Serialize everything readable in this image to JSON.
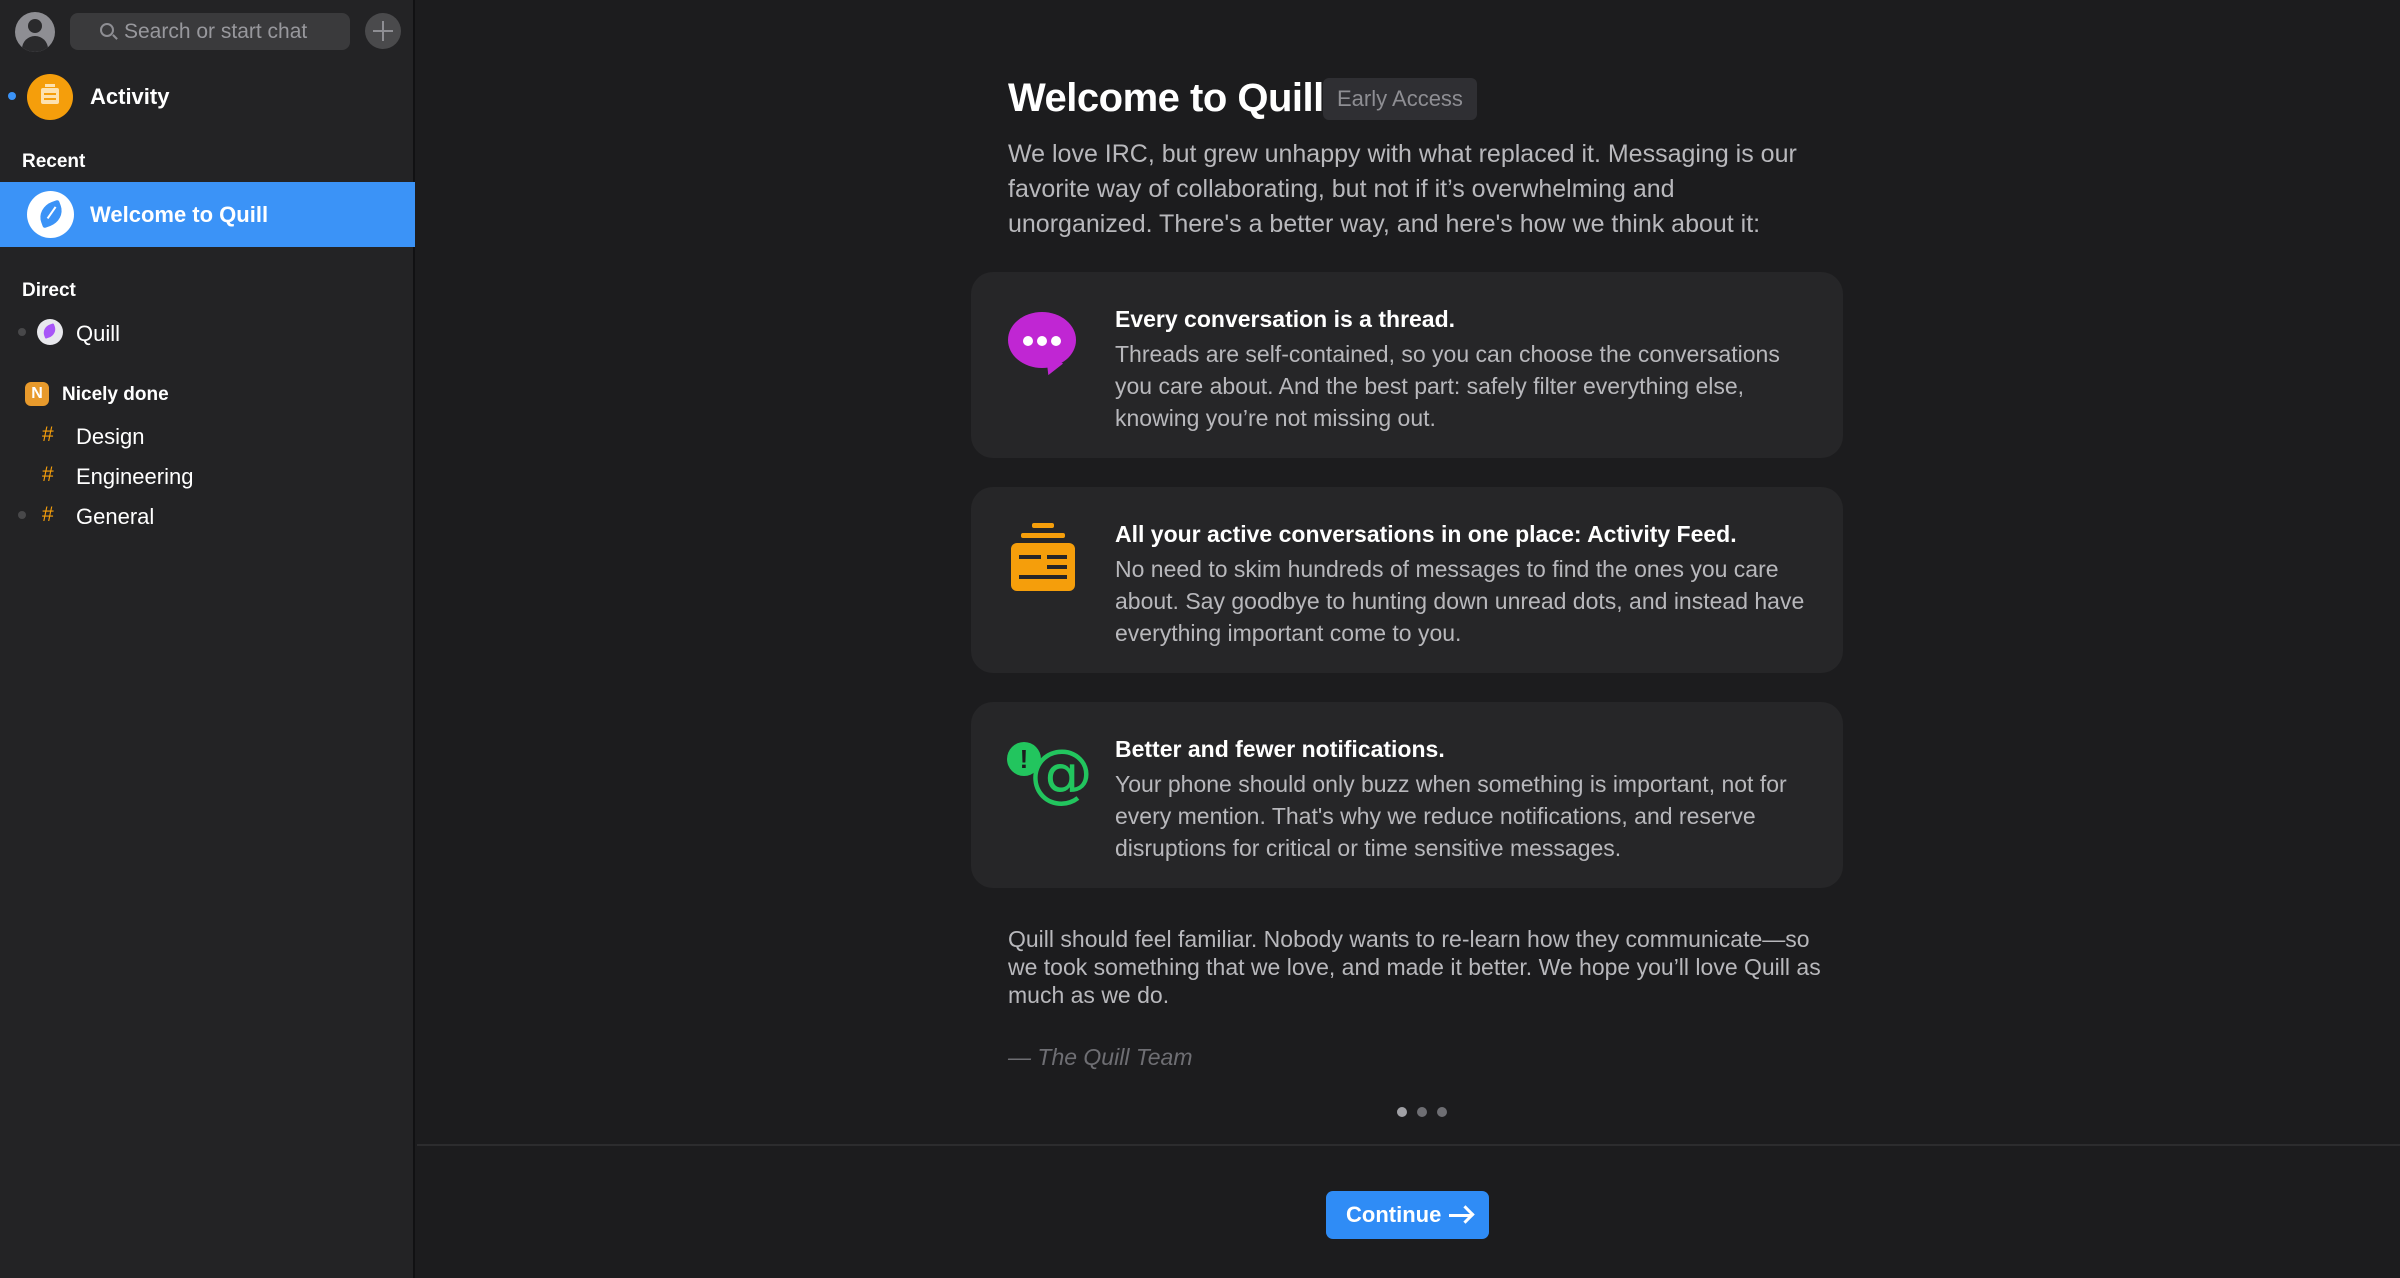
{
  "search": {
    "placeholder": "Search or start chat"
  },
  "sidebar": {
    "activity": {
      "label": "Activity",
      "icon": "activity-feed-icon"
    },
    "recent": {
      "label": "Recent",
      "items": [
        {
          "label": "Welcome to Quill",
          "selected": true
        }
      ]
    },
    "direct": {
      "label": "Direct",
      "items": [
        {
          "label": "Quill"
        }
      ]
    },
    "team": {
      "initial": "N",
      "label": "Nicely done",
      "channels": [
        {
          "hash": "#",
          "label": "Design"
        },
        {
          "hash": "#",
          "label": "Engineering"
        },
        {
          "hash": "#",
          "label": "General"
        }
      ]
    }
  },
  "main": {
    "title": "Welcome to Quill",
    "badge": "Early Access",
    "intro": "We love IRC, but grew unhappy with what replaced it. Messaging is our favorite way of collaborating, but not if it’s overwhelming and unorganized. There's a better way, and here's how we think about it:",
    "features": [
      {
        "icon": "chat-bubble-icon",
        "title": "Every conversation is a thread.",
        "desc": "Threads are self-contained, so you can choose the conversations you care about. And the best part: safely filter everything else, knowing you’re not missing out."
      },
      {
        "icon": "activity-feed-icon",
        "title": "All your active conversations in one place: Activity Feed.",
        "desc": "No need to skim hundreds of messages to find the ones you care about. Say goodbye to hunting down unread dots, and instead have everything important come to you."
      },
      {
        "icon": "notification-mention-icon",
        "title": "Better and fewer notifications.",
        "desc": "Your phone should only buzz when something is important, not for every mention. That's why we reduce notifications, and reserve disruptions for critical or time sensitive messages."
      }
    ],
    "outro": "Quill should feel familiar. Nobody wants to re-learn how they communicate—so we took something that we love, and made it better. We hope you’ll love Quill as much as we do.",
    "signature": "— The Quill Team",
    "pager": {
      "total": 3,
      "current": 1
    },
    "continue_label": "Continue"
  },
  "colors": {
    "accent": "#3b93f7",
    "activity": "#f59e0b",
    "chat": "#c026d3",
    "notify": "#22c55e"
  }
}
